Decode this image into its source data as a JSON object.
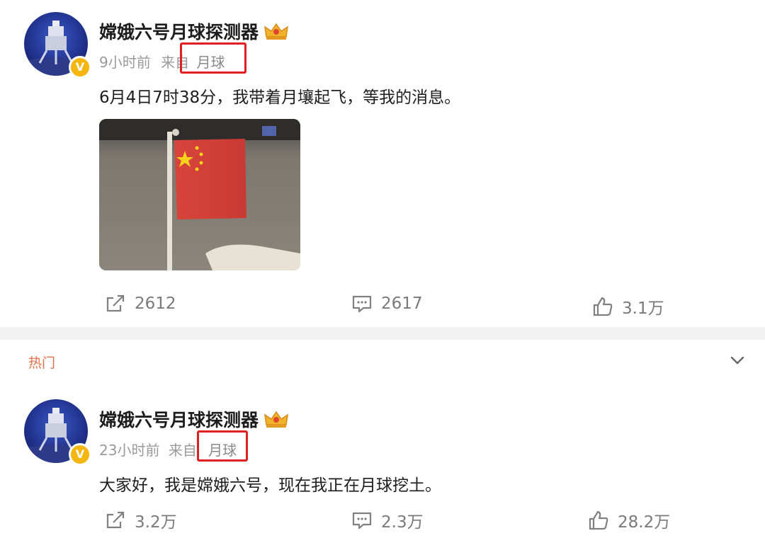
{
  "posts": [
    {
      "author": "嫦娥六号月球探测器",
      "time": "9小时前",
      "source_prefix": "来自",
      "source": "月球",
      "text": "6月4日7时38分，我带着月壤起飞，等我的消息。",
      "has_image": true,
      "repost_count": "2612",
      "comment_count": "2617",
      "like_count": "3.1万"
    },
    {
      "section_label": "热门",
      "author": "嫦娥六号月球探测器",
      "time": "23小时前",
      "source_prefix": "来自",
      "source": "月球",
      "text": "大家好，我是嫦娥六号，现在我正在月球挖土。",
      "repost_count": "3.2万",
      "comment_count": "2.3万",
      "like_count": "28.2万"
    }
  ],
  "icons": {
    "repost": "repost-icon",
    "comment": "comment-icon",
    "like": "thumbs-up-icon",
    "verified": "verified-badge-icon",
    "crown": "crown-icon",
    "expand": "chevron-down-icon"
  },
  "colors": {
    "highlight_box": "#e02020",
    "hot_label": "#e5704a",
    "verified": "#f5b70f",
    "divider": "#f2f2f2"
  }
}
